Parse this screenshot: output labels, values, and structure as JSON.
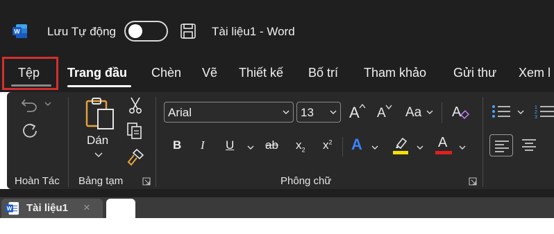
{
  "titlebar": {
    "app_icon": "word-app-icon",
    "autosave_label": "Lưu Tự động",
    "autosave_state": "off",
    "save_icon": "save-icon",
    "document_title": "Tài liệu1  -  Word"
  },
  "menu": {
    "tabs": [
      {
        "label": "Tệp",
        "active": false,
        "highlighted": true
      },
      {
        "label": "Trang đầu",
        "active": true
      },
      {
        "label": "Chèn",
        "active": false
      },
      {
        "label": "Vẽ",
        "active": false
      },
      {
        "label": "Thiết kế",
        "active": false
      },
      {
        "label": "Bố trí",
        "active": false
      },
      {
        "label": "Tham khảo",
        "active": false
      },
      {
        "label": "Gửi thư",
        "active": false
      },
      {
        "label": "Xem l",
        "active": false
      }
    ]
  },
  "ribbon": {
    "undo_group": {
      "label": "Hoàn Tác",
      "undo_icon": "undo-icon",
      "redo_icon": "redo-icon"
    },
    "clipboard_group": {
      "label": "Bảng tạm",
      "paste_label": "Dán",
      "paste_icon": "clipboard-paste-icon",
      "cut_icon": "scissors-icon",
      "copy_icon": "copy-icon",
      "format_painter_icon": "format-painter-icon"
    },
    "font_group": {
      "label": "Phông chữ",
      "font_name": "Arial",
      "font_size": "13",
      "grow_font": "A",
      "shrink_font": "A",
      "change_case": "Aa",
      "bold": "B",
      "italic": "I",
      "underline": "U",
      "strikethrough": "ab",
      "subscript": "x",
      "superscript": "x",
      "text_effects": "A",
      "font_color": "A",
      "highlight_color": "#f5e100",
      "font_color_value": "#e0201f"
    },
    "paragraph_group": {
      "bullets_icon": "bullets-icon",
      "numbering_icon": "numbering-icon",
      "align_left_icon": "align-left-icon",
      "align_center_icon": "align-center-icon"
    }
  },
  "document_tabs": {
    "items": [
      {
        "label": "Tài liệu1",
        "close": "×"
      }
    ]
  },
  "colors": {
    "titlebar_bg": "#1f1f1f",
    "ribbon_bg": "#292929",
    "highlight_border": "#d32f2f",
    "word_blue": "#185abd"
  }
}
